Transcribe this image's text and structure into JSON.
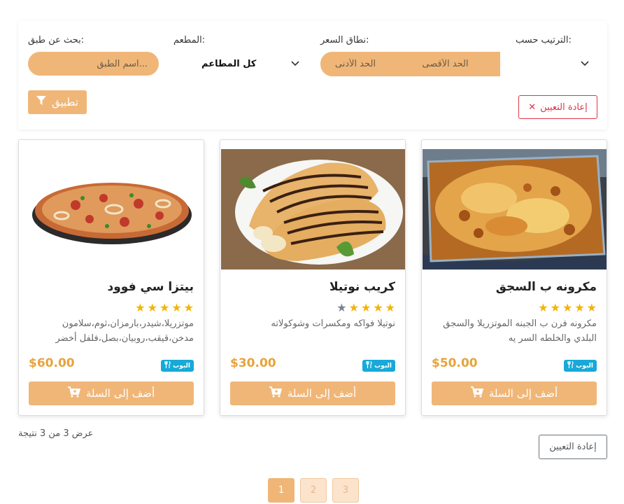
{
  "filters": {
    "search_label": ":بحث عن طبق",
    "search_placeholder": "...اسم الطبق",
    "restaurant_label": ":المطعم",
    "restaurant_value": "كل المطاعم",
    "price_label": ":نطاق السعر",
    "price_max_placeholder": "الحد الأقصى",
    "price_min_placeholder": "الحد الأدنى",
    "sort_label": ":الترتيب حسب",
    "apply_label": "تطبيق",
    "reset_label": "إعادة التعيين"
  },
  "products": [
    {
      "title": "مكرونه ب السجق",
      "rating": 5,
      "description": "مكرونه فرن ب الجبنه الموتزريلا والسجق البلدي والخلطه السر يه",
      "price": "$50.00",
      "badge": "البوب",
      "add_label": "أضف إلى السلة"
    },
    {
      "title": "كريب نوتيلا",
      "rating": 4,
      "description": "نوتيلا فواكه ومكسرات وشوكولاته",
      "price": "$30.00",
      "badge": "البوب",
      "add_label": "أضف إلى السلة"
    },
    {
      "title": "بيتزا سي فوود",
      "rating": 5,
      "description": "موتزريلا،شيدر،بارمزان،ثوم،سلامون مدخن،قيقب،روبيان،بصل،فلفل أخضر",
      "price": "$60.00",
      "badge": "البوب",
      "add_label": "أضف إلى السلة"
    }
  ],
  "results": {
    "count_text": "عرض 3 من 3 نتيجة",
    "reset_label": "إعادة التعيين"
  },
  "pagination": {
    "pages": [
      "1",
      "2",
      "3"
    ],
    "active": "1"
  },
  "colors": {
    "accent": "#f0b677",
    "price": "#e8a33a",
    "star": "#f5b301",
    "badge": "#17a9d8",
    "danger": "#dc3545"
  }
}
